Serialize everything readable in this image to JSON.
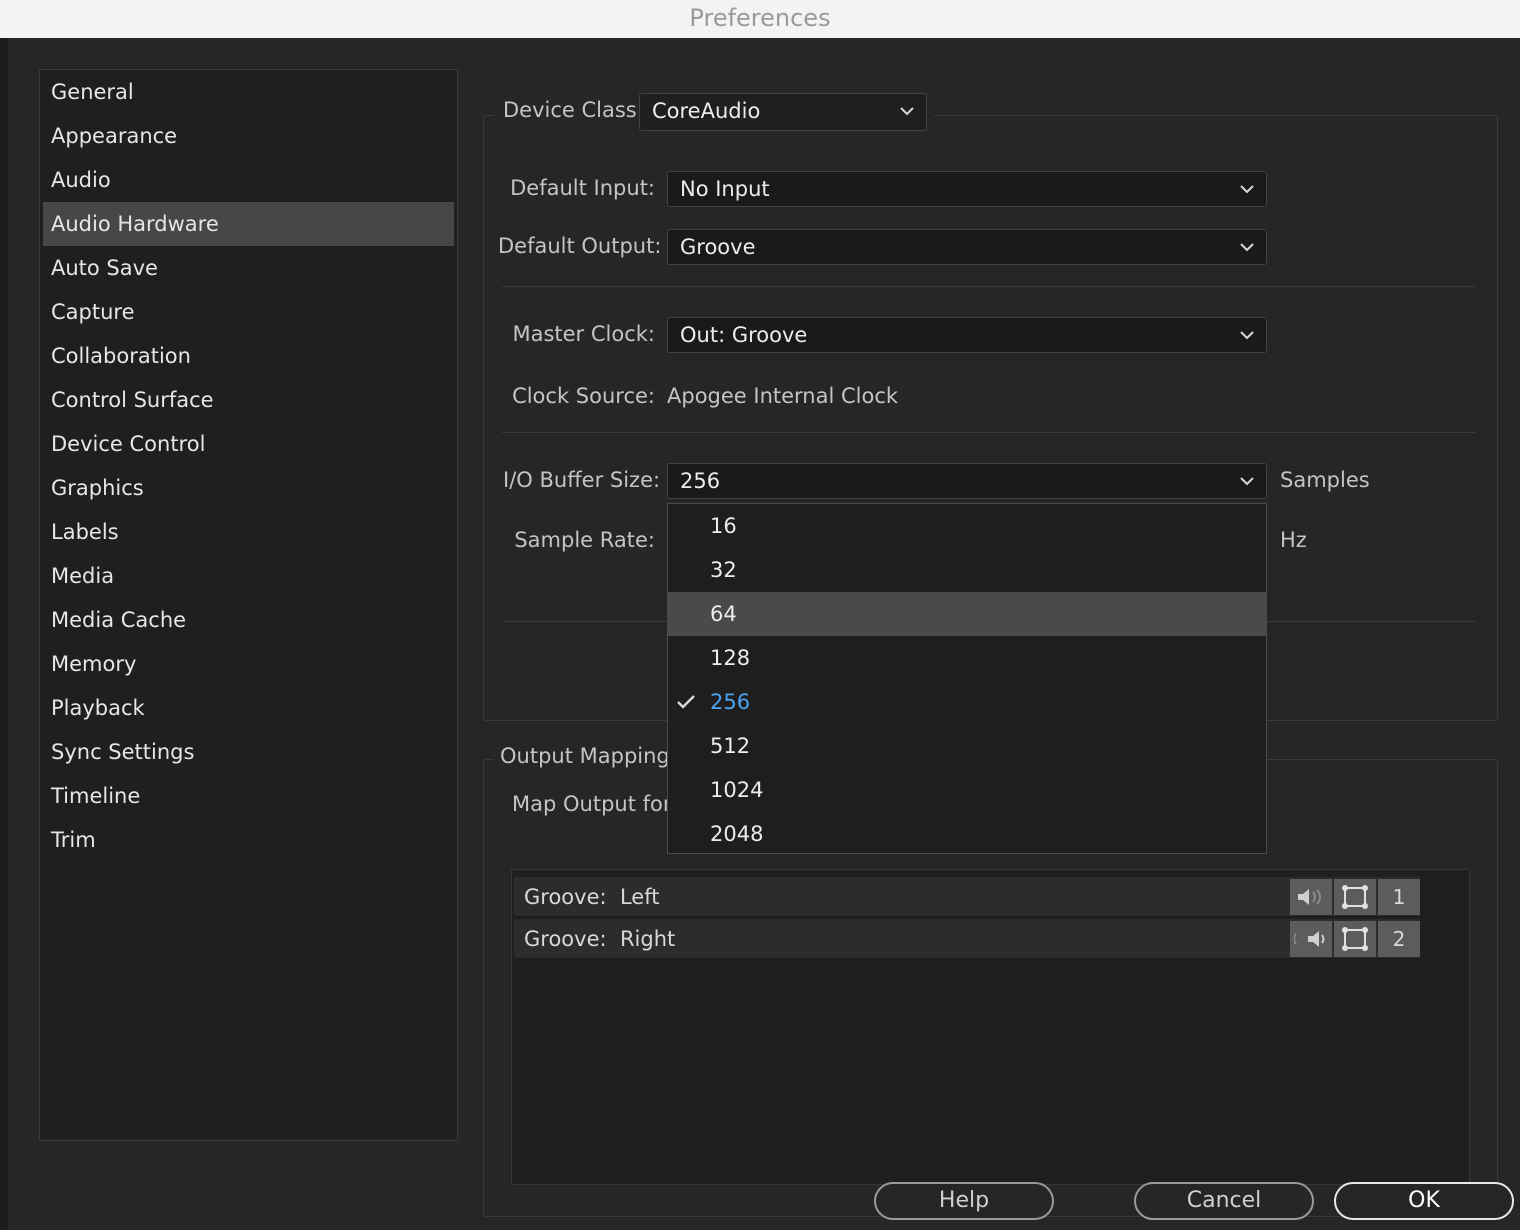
{
  "window": {
    "title": "Preferences"
  },
  "sidebar": {
    "items": [
      {
        "label": "General"
      },
      {
        "label": "Appearance"
      },
      {
        "label": "Audio"
      },
      {
        "label": "Audio Hardware",
        "selected": true
      },
      {
        "label": "Auto Save"
      },
      {
        "label": "Capture"
      },
      {
        "label": "Collaboration"
      },
      {
        "label": "Control Surface"
      },
      {
        "label": "Device Control"
      },
      {
        "label": "Graphics"
      },
      {
        "label": "Labels"
      },
      {
        "label": "Media"
      },
      {
        "label": "Media Cache"
      },
      {
        "label": "Memory"
      },
      {
        "label": "Playback"
      },
      {
        "label": "Sync Settings"
      },
      {
        "label": "Timeline"
      },
      {
        "label": "Trim"
      }
    ]
  },
  "device": {
    "class_label": "Device Class:",
    "class_value": "CoreAudio",
    "input_label": "Default Input:",
    "input_value": "No Input",
    "output_label": "Default Output:",
    "output_value": "Groove",
    "clock_label": "Master Clock:",
    "clock_value": "Out: Groove",
    "source_label": "Clock Source:",
    "source_value": "Apogee Internal Clock",
    "buffer_label": "I/O Buffer Size:",
    "buffer_value": "256",
    "buffer_unit": "Samples",
    "rate_label": "Sample Rate:",
    "rate_unit": "Hz"
  },
  "buffer_menu": {
    "options": [
      "16",
      "32",
      "64",
      "128",
      "256",
      "512",
      "1024",
      "2048"
    ],
    "highlighted": "64",
    "selected": "256"
  },
  "output_mapping": {
    "title": "Output Mapping",
    "map_label": "Map Output for",
    "rows": [
      {
        "device": "Groove:",
        "channel": "Left",
        "number": "1"
      },
      {
        "device": "Groove:",
        "channel": "Right",
        "number": "2"
      }
    ]
  },
  "buttons": {
    "help": "Help",
    "cancel": "Cancel",
    "ok": "OK"
  },
  "colors": {
    "accent": "#4aa3f0",
    "background": "#262626",
    "selection": "#474747"
  }
}
